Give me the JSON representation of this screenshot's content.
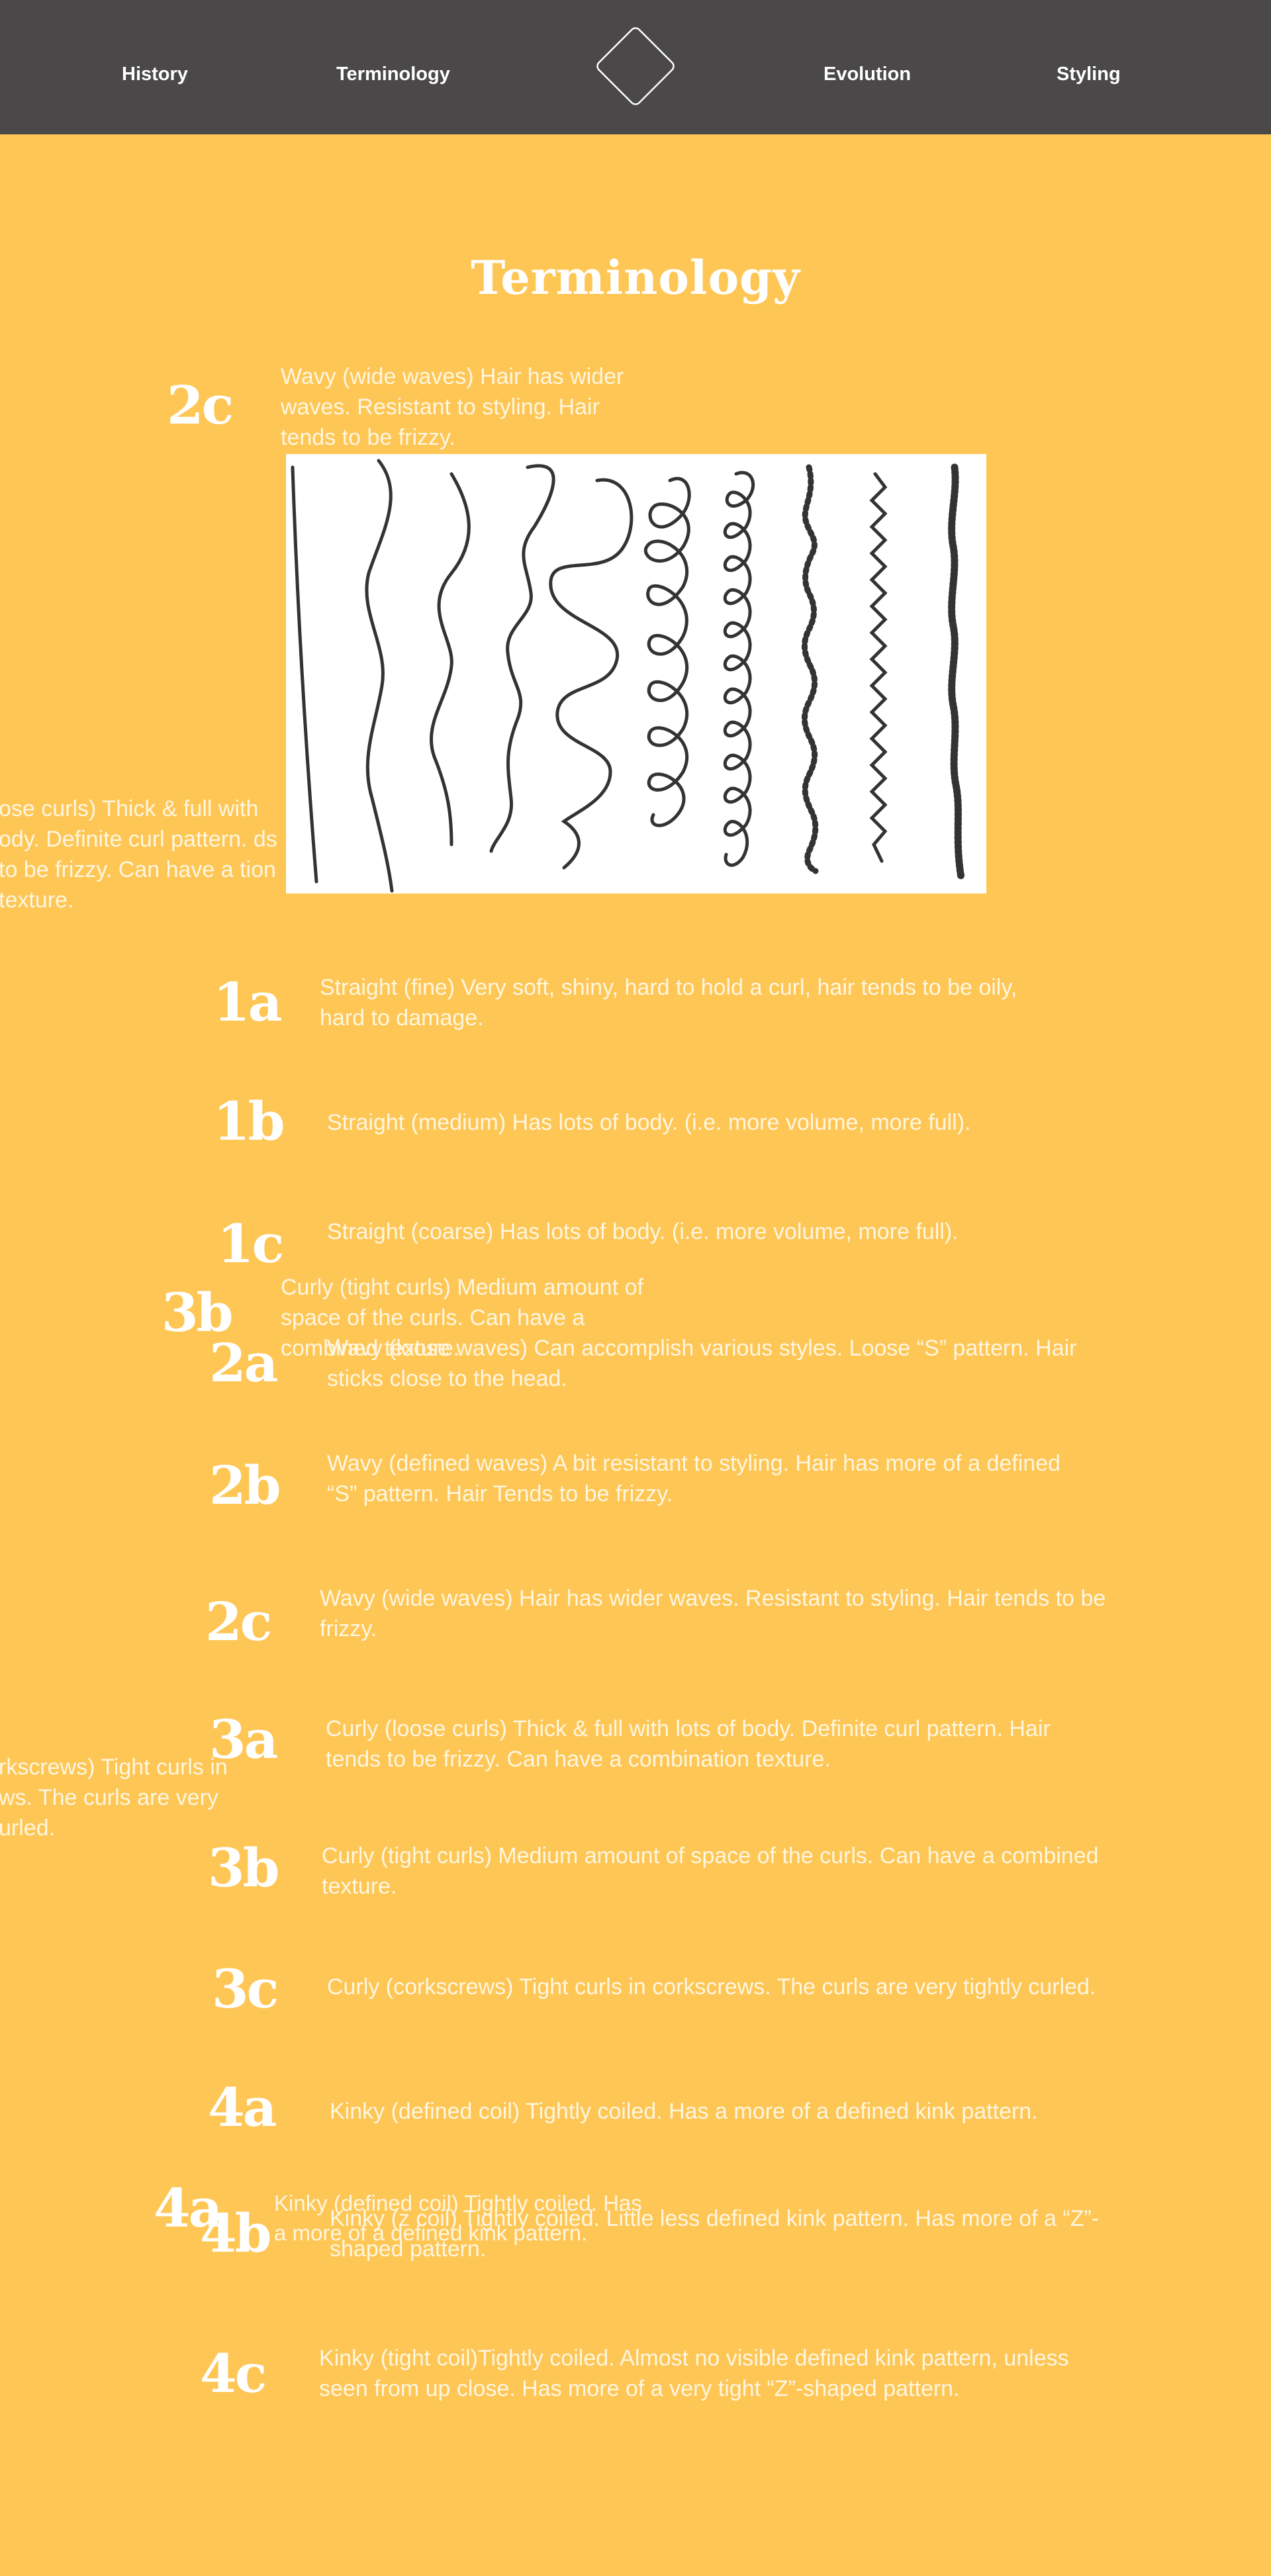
{
  "nav": {
    "links": [
      "History",
      "Terminology",
      "Evolution",
      "Styling"
    ]
  },
  "page": {
    "title": "Terminology"
  },
  "overlays": [
    {
      "code": "2c",
      "text": "Wavy (wide waves) Hair has wider waves. Resistant to styling. Hair tends to be frizzy."
    },
    {
      "code": "",
      "text": "ose curls)   Thick & full with ody. Definite curl pattern. ds to be frizzy. Can have a tion texture."
    },
    {
      "code": "3b",
      "text": "Curly (tight curls) Medium amount of space of the curls. Can have a combined texture."
    },
    {
      "code": "",
      "text": "rkscrews)  Tight curls in ws. The curls are very urled."
    },
    {
      "code": "4a",
      "text": "Kinky (defined coil) Tightly coiled. Has a more of a defined kink pattern."
    }
  ],
  "types": [
    {
      "code": "1a",
      "text": "Straight (fine)  Very soft, shiny, hard to hold a curl, hair tends to be oily, hard to damage."
    },
    {
      "code": "1b",
      "text": "Straight (medium) Has lots of body. (i.e. more volume, more full)."
    },
    {
      "code": "1c",
      "text": "Straight (coarse) Has lots of body. (i.e. more volume, more full)."
    },
    {
      "code": "2a",
      "text": "Wavy (loose waves) Can accomplish various styles. Loose “S” pattern. Hair sticks close to the head."
    },
    {
      "code": "2b",
      "text": "Wavy (defined waves) A bit resistant to styling. Hair has more of a defined “S” pattern. Hair Tends to be frizzy."
    },
    {
      "code": "2c",
      "text": "Wavy (wide waves)  Hair has wider waves. Resistant to styling. Hair tends to be frizzy."
    },
    {
      "code": "3a",
      "text": "Curly (loose curls)   Thick & full with lots of body. Definite curl pattern. Hair tends to be frizzy. Can have a combination texture."
    },
    {
      "code": "3b",
      "text": "Curly (tight curls)  Medium amount of space of the curls. Can have a combined texture."
    },
    {
      "code": "3c",
      "text": "Curly (corkscrews)  Tight curls in corkscrews. The curls are very tightly curled."
    },
    {
      "code": "4a",
      "text": "Kinky (defined coil) Tightly coiled. Has a more of a defined kink pattern."
    },
    {
      "code": "4b",
      "text": "Kinky (z coil)  Tightly coiled. Little less defined kink pattern. Has more of a “Z”-shaped pattern."
    },
    {
      "code": "4c",
      "text": "Kinky (tight coil)Tightly coiled. Almost no visible defined kink pattern, unless seen from up close. Has more of a very tight “Z”-shaped pattern."
    }
  ],
  "colors": {
    "background": "#FEC655",
    "nav": "#4A4848",
    "text": "#FFFFFF"
  },
  "icons": [
    "diamond-logo-icon",
    "hair-type-curl-chart"
  ]
}
